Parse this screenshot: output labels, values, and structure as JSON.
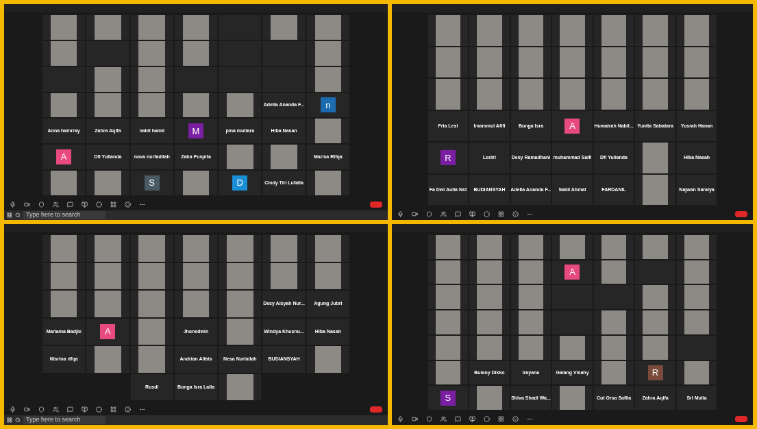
{
  "panels": [
    {
      "taskbar": true,
      "search": {
        "placeholder": "Type here to search"
      },
      "tiles": [
        [
          {
            "kind": "video"
          },
          {
            "kind": "video"
          },
          {
            "kind": "video"
          },
          {
            "kind": "video"
          },
          {
            "kind": "blank"
          },
          {
            "kind": "video"
          },
          {
            "kind": "video"
          }
        ],
        [
          {
            "kind": "video"
          },
          {
            "kind": "blank"
          },
          {
            "kind": "video"
          },
          {
            "kind": "video"
          },
          {
            "kind": "blank"
          },
          {
            "kind": "blank"
          },
          {
            "kind": "video"
          }
        ],
        [
          {
            "kind": "blank"
          },
          {
            "kind": "video"
          },
          {
            "kind": "video"
          },
          {
            "kind": "blank"
          },
          {
            "kind": "blank"
          },
          {
            "kind": "blank"
          },
          {
            "kind": "video"
          }
        ],
        [
          {
            "kind": "video"
          },
          {
            "kind": "video"
          },
          {
            "kind": "video"
          },
          {
            "kind": "video"
          },
          {
            "kind": "video"
          },
          {
            "kind": "name",
            "name": "Adella Ananda F..."
          },
          {
            "kind": "avatar",
            "letter": "n",
            "color": "#1a6bb0"
          }
        ],
        [
          {
            "kind": "name",
            "name": "Anna hamrray"
          },
          {
            "kind": "name",
            "name": "Zahra Aqifa"
          },
          {
            "kind": "name",
            "name": "nabil hamil"
          },
          {
            "kind": "avatar",
            "letter": "M",
            "color": "#7b1fa2"
          },
          {
            "kind": "name",
            "name": "pina mutiara"
          },
          {
            "kind": "name",
            "name": "Hiba Nasan"
          },
          {
            "kind": "video"
          }
        ],
        [
          {
            "kind": "avatar",
            "letter": "A",
            "color": "#e84a7f"
          },
          {
            "kind": "name",
            "name": "Dfi Yulianda"
          },
          {
            "kind": "name",
            "name": "nova nurfadilah"
          },
          {
            "kind": "name",
            "name": "Zaba Puspita"
          },
          {
            "kind": "video"
          },
          {
            "kind": "video"
          },
          {
            "kind": "name",
            "name": "Marisa Rifqa"
          }
        ],
        [
          {
            "kind": "video"
          },
          {
            "kind": "video"
          },
          {
            "kind": "avatar",
            "letter": "S",
            "color": "#4b5b66"
          },
          {
            "kind": "video"
          },
          {
            "kind": "avatar",
            "letter": "D",
            "color": "#1a8fd6"
          },
          {
            "kind": "name",
            "name": "Cindy Tiri Lufalia"
          },
          {
            "kind": "video"
          }
        ]
      ]
    },
    {
      "taskbar": false,
      "tiles": [
        [
          {
            "kind": "video"
          },
          {
            "kind": "video"
          },
          {
            "kind": "video"
          },
          {
            "kind": "video"
          },
          {
            "kind": "video"
          },
          {
            "kind": "video"
          },
          {
            "kind": "video"
          }
        ],
        [
          {
            "kind": "video"
          },
          {
            "kind": "video"
          },
          {
            "kind": "video"
          },
          {
            "kind": "video"
          },
          {
            "kind": "video"
          },
          {
            "kind": "video"
          },
          {
            "kind": "video"
          }
        ],
        [
          {
            "kind": "video"
          },
          {
            "kind": "video"
          },
          {
            "kind": "video"
          },
          {
            "kind": "video"
          },
          {
            "kind": "video"
          },
          {
            "kind": "video"
          },
          {
            "kind": "video"
          }
        ],
        [
          {
            "kind": "name",
            "name": "Fria Lesi"
          },
          {
            "kind": "name",
            "name": "Imammul Afifi"
          },
          {
            "kind": "name",
            "name": "Bunga Isra"
          },
          {
            "kind": "avatar",
            "letter": "A",
            "color": "#e84a7f"
          },
          {
            "kind": "name",
            "name": "Humairah Nabil..."
          },
          {
            "kind": "name",
            "name": "Yunita Sabatara"
          },
          {
            "kind": "name",
            "name": "Yusrah Hanan"
          }
        ],
        [
          {
            "kind": "avatar",
            "letter": "R",
            "color": "#7b1fa2"
          },
          {
            "kind": "name",
            "name": "Lestri"
          },
          {
            "kind": "name",
            "name": "Desy Ramadhani"
          },
          {
            "kind": "name",
            "name": "muhammad Saifi"
          },
          {
            "kind": "name",
            "name": "Dfi Yulianda"
          },
          {
            "kind": "video"
          },
          {
            "kind": "name",
            "name": "Hiba Nasah"
          }
        ],
        [
          {
            "kind": "name",
            "name": "Fa Dwi Aulia Nst"
          },
          {
            "kind": "name",
            "name": "BUDIANSYAH"
          },
          {
            "kind": "name",
            "name": "Adella Ananda F..."
          },
          {
            "kind": "name",
            "name": "Sabil Ahmat"
          },
          {
            "kind": "name",
            "name": "FARDANIL"
          },
          {
            "kind": "video"
          },
          {
            "kind": "name",
            "name": "Najwan Saraiya"
          }
        ]
      ]
    },
    {
      "taskbar": true,
      "search": {
        "placeholder": "Type here to search"
      },
      "tiles": [
        [
          {
            "kind": "video"
          },
          {
            "kind": "video"
          },
          {
            "kind": "video"
          },
          {
            "kind": "video"
          },
          {
            "kind": "video"
          },
          {
            "kind": "video"
          },
          {
            "kind": "video"
          }
        ],
        [
          {
            "kind": "video"
          },
          {
            "kind": "video"
          },
          {
            "kind": "video"
          },
          {
            "kind": "video"
          },
          {
            "kind": "video"
          },
          {
            "kind": "video"
          },
          {
            "kind": "video"
          }
        ],
        [
          {
            "kind": "video"
          },
          {
            "kind": "video"
          },
          {
            "kind": "video"
          },
          {
            "kind": "video"
          },
          {
            "kind": "video"
          },
          {
            "kind": "name",
            "name": "Desy Aisyah Nur..."
          },
          {
            "kind": "name",
            "name": "Agung Jubri"
          }
        ],
        [
          {
            "kind": "name",
            "name": "Mariama Badjie"
          },
          {
            "kind": "avatar",
            "letter": "A",
            "color": "#e84a7f"
          },
          {
            "kind": "video"
          },
          {
            "kind": "name",
            "name": "Jhonedwin"
          },
          {
            "kind": "video"
          },
          {
            "kind": "name",
            "name": "Windya Khusnu..."
          },
          {
            "kind": "name",
            "name": "Hiba Nasah"
          }
        ],
        [
          {
            "kind": "name",
            "name": "Nisrina rifqa"
          },
          {
            "kind": "video"
          },
          {
            "kind": "video"
          },
          {
            "kind": "name",
            "name": "Andrian Alfais"
          },
          {
            "kind": "name",
            "name": "Nesa Nurlailah"
          },
          {
            "kind": "name",
            "name": "BUDIANSYAH"
          },
          {
            "kind": "video"
          }
        ],
        [
          {
            "kind": "empty"
          },
          {
            "kind": "empty"
          },
          {
            "kind": "name",
            "name": "Rusdi"
          },
          {
            "kind": "name",
            "name": "Bunga Isra Laila"
          },
          {
            "kind": "video"
          },
          {
            "kind": "empty"
          },
          {
            "kind": "empty"
          }
        ]
      ]
    },
    {
      "taskbar": false,
      "tiles": [
        [
          {
            "kind": "video"
          },
          {
            "kind": "video"
          },
          {
            "kind": "video"
          },
          {
            "kind": "video"
          },
          {
            "kind": "video"
          },
          {
            "kind": "video"
          },
          {
            "kind": "video"
          }
        ],
        [
          {
            "kind": "video"
          },
          {
            "kind": "video"
          },
          {
            "kind": "video"
          },
          {
            "kind": "avatar",
            "letter": "A",
            "color": "#e84a7f"
          },
          {
            "kind": "video"
          },
          {
            "kind": "blank"
          },
          {
            "kind": "video"
          }
        ],
        [
          {
            "kind": "video"
          },
          {
            "kind": "video"
          },
          {
            "kind": "video"
          },
          {
            "kind": "blank"
          },
          {
            "kind": "blank"
          },
          {
            "kind": "video"
          },
          {
            "kind": "video"
          }
        ],
        [
          {
            "kind": "video"
          },
          {
            "kind": "video"
          },
          {
            "kind": "video"
          },
          {
            "kind": "blank"
          },
          {
            "kind": "video"
          },
          {
            "kind": "video"
          },
          {
            "kind": "video"
          }
        ],
        [
          {
            "kind": "video"
          },
          {
            "kind": "video"
          },
          {
            "kind": "video"
          },
          {
            "kind": "video"
          },
          {
            "kind": "video"
          },
          {
            "kind": "video"
          },
          {
            "kind": "blank"
          }
        ],
        [
          {
            "kind": "video"
          },
          {
            "kind": "name",
            "name": "Bulany Dikko"
          },
          {
            "kind": "name",
            "name": "Irayana"
          },
          {
            "kind": "name",
            "name": "Galang Visahy"
          },
          {
            "kind": "video"
          },
          {
            "kind": "avatar",
            "letter": "R",
            "color": "#7a4b3a"
          },
          {
            "kind": "video"
          }
        ],
        [
          {
            "kind": "avatar",
            "letter": "S",
            "color": "#7b1fa2"
          },
          {
            "kind": "video"
          },
          {
            "kind": "name",
            "name": "Shiva Shadi Wa..."
          },
          {
            "kind": "video"
          },
          {
            "kind": "name",
            "name": "Cut Orsa Safila"
          },
          {
            "kind": "name",
            "name": "Zahra Aqifa"
          },
          {
            "kind": "name",
            "name": "Sri Mulia"
          }
        ]
      ]
    }
  ]
}
